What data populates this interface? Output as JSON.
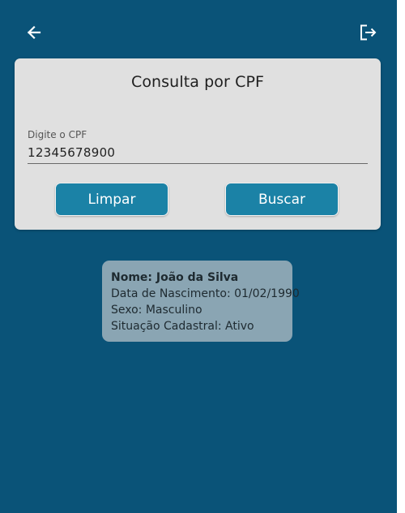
{
  "search_card": {
    "title": "Consulta por CPF",
    "cpf_label": "Digite o CPF",
    "cpf_value": "12345678900",
    "clear_label": "Limpar",
    "search_label": "Buscar"
  },
  "result": {
    "name": "Nome: João da Silva",
    "birth_date": "Data de Nascimento: 01/02/1990",
    "sex": "Sexo: Masculino",
    "status": "Situação Cadastral: Ativo"
  },
  "icons": {
    "back": "arrow-left-icon",
    "logout": "logout-icon"
  },
  "colors": {
    "background": "#0a5378",
    "card": "#e0e0e0",
    "button": "#1b82a6",
    "result_card": "#8aa5b3"
  }
}
